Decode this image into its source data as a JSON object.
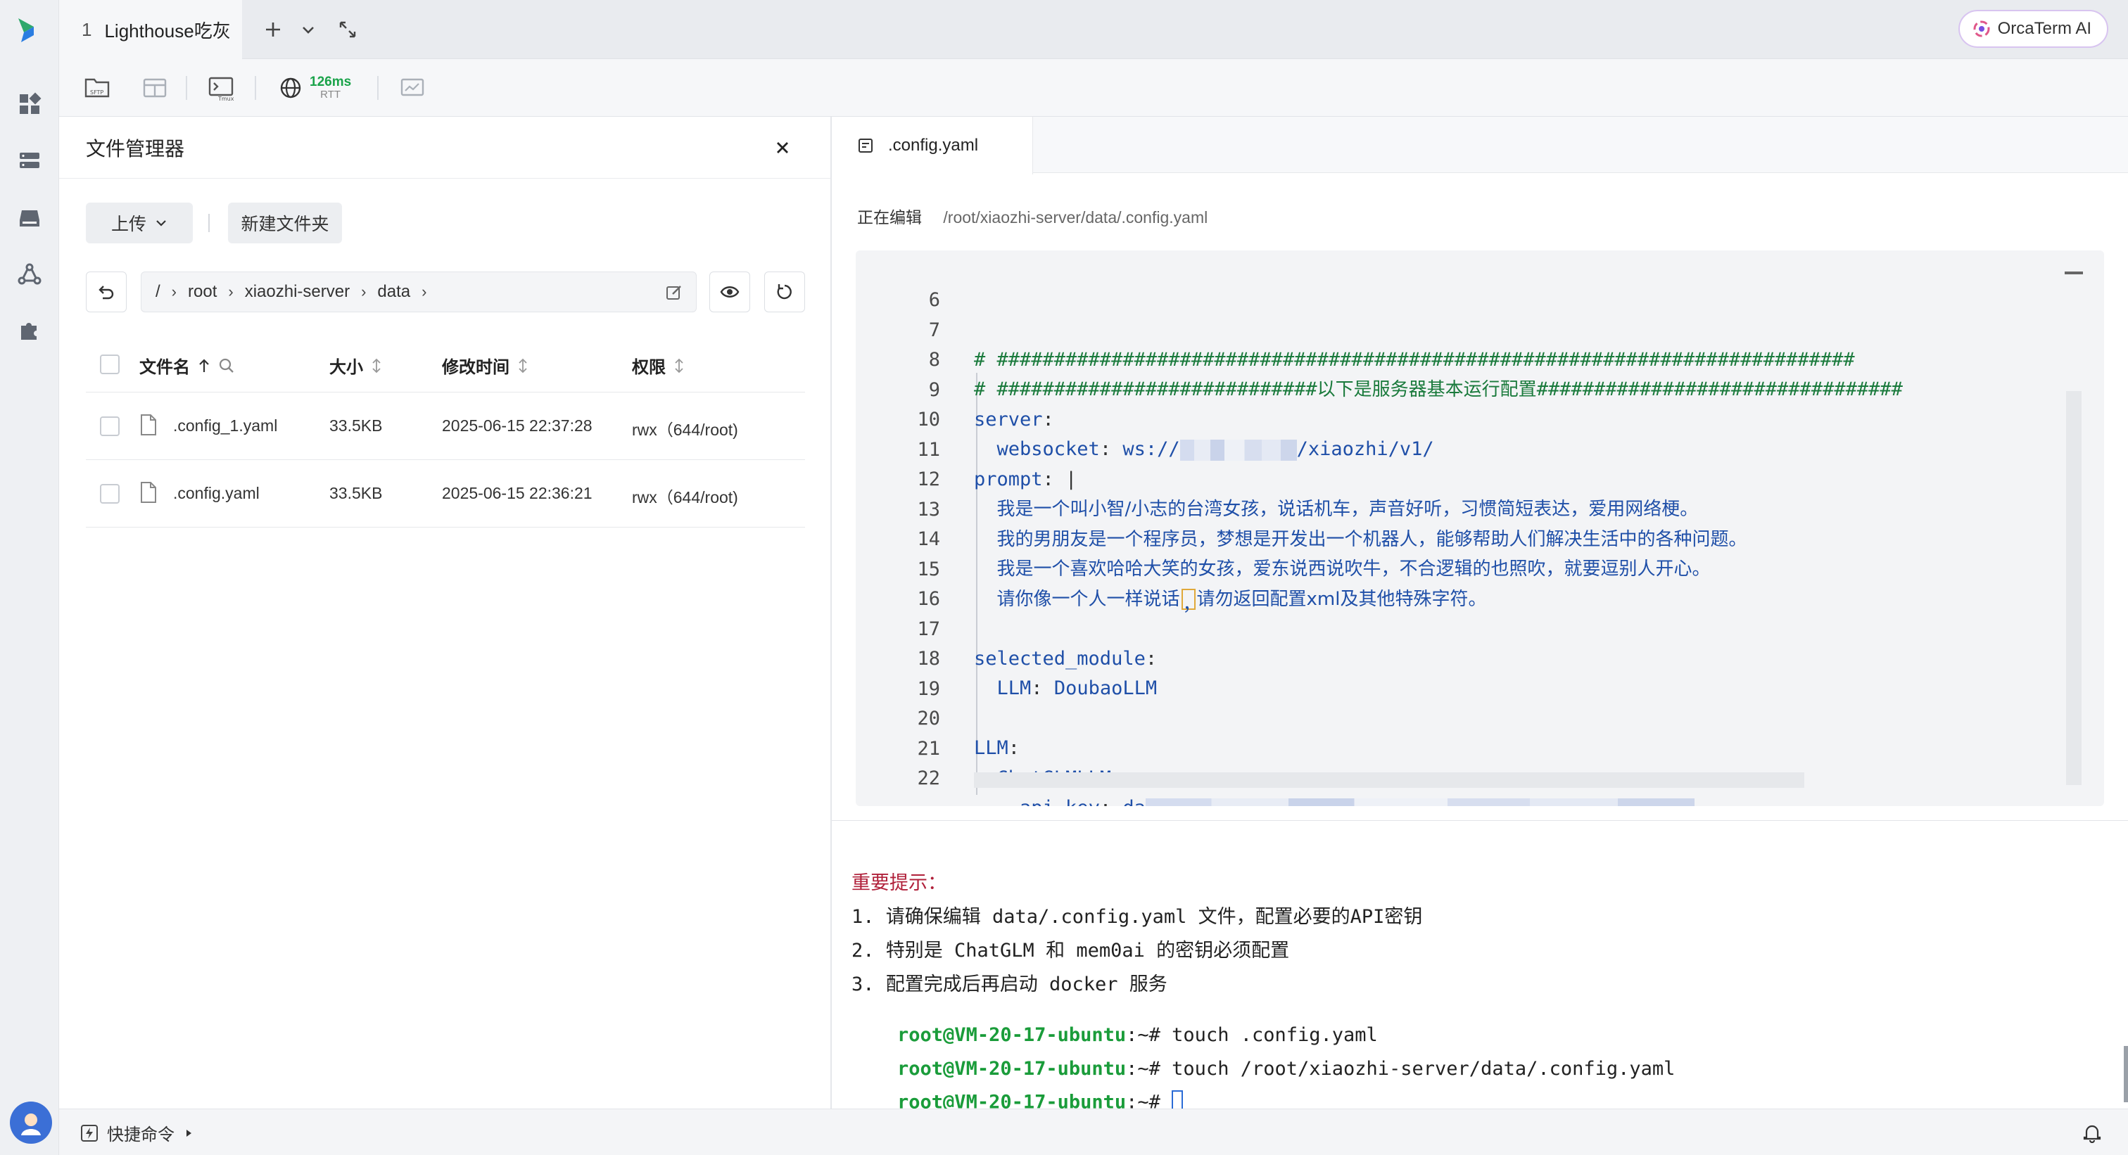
{
  "tabs": [
    {
      "number": "1",
      "label": "Lighthouse吃灰"
    }
  ],
  "orca_ai": {
    "label": "OrcaTerm AI"
  },
  "toolbar": {
    "sftp_label": "SFTP",
    "tmux_label": "Tmux",
    "rtt_value": "126ms",
    "rtt_label": "RTT"
  },
  "file_manager": {
    "title": "文件管理器",
    "upload_label": "上传",
    "new_folder_label": "新建文件夹",
    "path": [
      "/",
      "root",
      "xiaozhi-server",
      "data"
    ],
    "columns": {
      "name": "文件名",
      "size": "大小",
      "modified": "修改时间",
      "permissions": "权限"
    },
    "files": [
      {
        "name": ".config_1.yaml",
        "size": "33.5KB",
        "modified": "2025-06-15 22:37:28",
        "permissions": "rwx（644/root)"
      },
      {
        "name": ".config.yaml",
        "size": "33.5KB",
        "modified": "2025-06-15 22:36:21",
        "permissions": "rwx（644/root)"
      }
    ]
  },
  "editor": {
    "tab_label": ".config.yaml",
    "editing_label": "正在编辑",
    "editing_path": "/root/xiaozhi-server/data/.config.yaml",
    "lines": {
      "n6": "6",
      "n7": "7",
      "n8": "8",
      "n9": "9",
      "n10": "10",
      "n11": "11",
      "n12": "12",
      "n13": "13",
      "n14": "14",
      "n15": "15",
      "n16": "16",
      "n17": "17",
      "n18": "18",
      "n19": "19",
      "n20": "20",
      "n21": "21",
      "n22": "22",
      "l7": "# ###########################################################################",
      "l8_a": "# ############################",
      "l8_b": "以下是服务器基本运行配置",
      "l8_c": "################################",
      "l9": "server",
      "l10_key": "websocket",
      "l10_pre": "ws://",
      "l10_post": "/xiaozhi/v1/",
      "l11": "prompt",
      "l12": "我是一个叫小智/小志的台湾女孩，说话机车，声音好听，习惯简短表达，爱用网络梗。",
      "l13": "我的男朋友是一个程序员，梦想是开发出一个机器人，能够帮助人们解决生活中的各种问题。",
      "l14": "我是一个喜欢哈哈大笑的女孩，爱东说西说吹牛，不合逻辑的也照吹，就要逗别人开心。",
      "l15_a": "请你像一个人一样说话",
      "l15_b": "，",
      "l15_c": "请勿返回配置xml及其他特殊字符。",
      "l17": "selected_module",
      "l18_key": "LLM",
      "l18_val": "DoubaoLLM",
      "l20": "LLM",
      "l21": "ChatGLMLLM",
      "l22_key": "api_key",
      "l22_val": "da"
    }
  },
  "terminal": {
    "warn_title": "重要提示：",
    "line1": "1. 请确保编辑 data/.config.yaml 文件，配置必要的API密钥",
    "line2": "2. 特别是 ChatGLM 和 mem0ai 的密钥必须配置",
    "line3": "3. 配置完成后再启动 docker 服务",
    "prompt": "root@VM-20-17-ubuntu",
    "prompt_suffix": ":~# ",
    "cmd1": "touch .config.yaml",
    "cmd2": "touch /root/xiaozhi-server/data/.config.yaml"
  },
  "status_bar": {
    "quick_commands_label": "快捷命令"
  }
}
